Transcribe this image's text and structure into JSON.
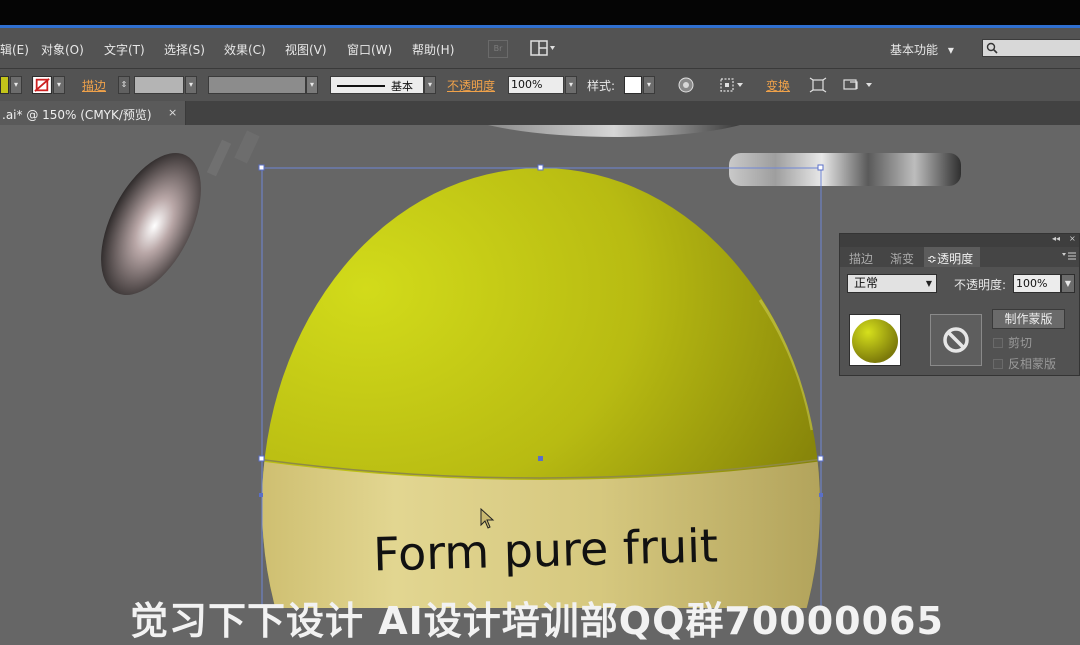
{
  "menubar": {
    "items": [
      "辑(E)",
      "对象(O)",
      "文字(T)",
      "选择(S)",
      "效果(C)",
      "视图(V)",
      "窗口(W)",
      "帮助(H)"
    ],
    "bridge_label": "Br",
    "workspace_label": "基本功能",
    "workspace_arrow": "▾",
    "search_placeholder": ""
  },
  "control_bar": {
    "fill_color": "#c3c41a",
    "stroke_label": "描边",
    "stroke_style_name": "基本",
    "opacity_label": "不透明度",
    "opacity_value": "100%",
    "style_label": "样式",
    "transform_label": "变换",
    "arrow": "▾"
  },
  "document_tab": {
    "title": ".ai* @ 150% (CMYK/预览)",
    "close": "×"
  },
  "artwork": {
    "label_text": "Form pure fruit",
    "sphere_color": "#c8d019",
    "label_band_color": "#d8cb82"
  },
  "transparency_panel": {
    "collapse_icon": "◂◂",
    "close_icon": "×",
    "tabs": [
      "描边",
      "渐变",
      "透明度"
    ],
    "active_tab_prefix": "≎",
    "blend_mode": "正常",
    "opacity_label": "不透明度:",
    "opacity_value": "100%",
    "make_mask_label": "制作蒙版",
    "clip_label": "剪切",
    "invert_mask_label": "反相蒙版"
  },
  "watermark": {
    "text": "觉习下下设计 AI设计培训部QQ群70000065"
  }
}
